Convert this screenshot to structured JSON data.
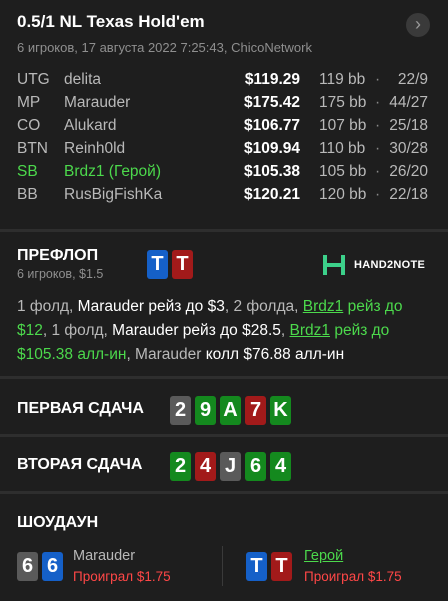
{
  "header": {
    "title": "0.5/1 NL Texas Hold'em",
    "subtitle": "6 игроков, 17 августа 2022 7:25:43, ChicoNetwork"
  },
  "players": [
    {
      "pos": "UTG",
      "name": "delita",
      "stack": "$119.29",
      "bb": "119 bb",
      "sep": "·",
      "ratio": "22/9",
      "hero": false
    },
    {
      "pos": "MP",
      "name": "Marauder",
      "stack": "$175.42",
      "bb": "175 bb",
      "sep": "·",
      "ratio": "44/27",
      "hero": false
    },
    {
      "pos": "CO",
      "name": "Alukard",
      "stack": "$106.77",
      "bb": "107 bb",
      "sep": "·",
      "ratio": "25/18",
      "hero": false
    },
    {
      "pos": "BTN",
      "name": "Reinh0ld",
      "stack": "$109.94",
      "bb": "110 bb",
      "sep": "·",
      "ratio": "30/28",
      "hero": false
    },
    {
      "pos": "SB",
      "name": "Brdz1 (Герой)",
      "stack": "$105.38",
      "bb": "105 bb",
      "sep": "·",
      "ratio": "26/20",
      "hero": true
    },
    {
      "pos": "BB",
      "name": "RusBigFishKa",
      "stack": "$120.21",
      "bb": "120 bb",
      "sep": "·",
      "ratio": "22/18",
      "hero": false
    }
  ],
  "preflop": {
    "heading": "ПРЕФЛОП",
    "sub": "6 игроков, $1.5",
    "hero_cards": [
      {
        "rank": "T",
        "suit": "blue"
      },
      {
        "rank": "T",
        "suit": "red"
      }
    ],
    "brand": "HAND2NOTE",
    "actions": {
      "a1": "1 фолд, ",
      "a2": "Marauder",
      "a3": " рейз до $3",
      "a4": ", 2 фолда, ",
      "a5": "Brdz1",
      "a6": " рейз до $12",
      "a7": ", 1 фолд, ",
      "a8": "Marauder",
      "a9": " рейз до $28.5",
      "a10": ", ",
      "a11": "Brdz1",
      "a12": " рейз до $105.38 алл-ин",
      "a13": ", Marauder ",
      "a14": "колл $76.88 алл-ин"
    }
  },
  "run1": {
    "heading": "ПЕРВАЯ СДАЧА",
    "cards": [
      {
        "rank": "2",
        "suit": "gray"
      },
      {
        "rank": "9",
        "suit": "green"
      },
      {
        "rank": "A",
        "suit": "green"
      },
      {
        "rank": "7",
        "suit": "red"
      },
      {
        "rank": "K",
        "suit": "green"
      }
    ]
  },
  "run2": {
    "heading": "ВТОРАЯ СДАЧА",
    "cards": [
      {
        "rank": "2",
        "suit": "green"
      },
      {
        "rank": "4",
        "suit": "red"
      },
      {
        "rank": "J",
        "suit": "gray"
      },
      {
        "rank": "6",
        "suit": "green"
      },
      {
        "rank": "4",
        "suit": "green"
      }
    ]
  },
  "showdown": {
    "heading": "ШОУДАУН",
    "players": [
      {
        "name": "Marauder",
        "result": "Проиграл $1.75",
        "cards": [
          {
            "rank": "6",
            "suit": "gray"
          },
          {
            "rank": "6",
            "suit": "blue"
          }
        ],
        "hero": false
      },
      {
        "name": "Герой",
        "result": "Проиграл $1.75",
        "cards": [
          {
            "rank": "T",
            "suit": "blue"
          },
          {
            "rank": "T",
            "suit": "red"
          }
        ],
        "hero": true
      }
    ]
  },
  "colors": {
    "hero": "#4cd94c",
    "loss": "#ff4747",
    "blue": "#1560c8",
    "red": "#a21a1a",
    "green": "#14891e",
    "gray": "#5a5a5a"
  }
}
